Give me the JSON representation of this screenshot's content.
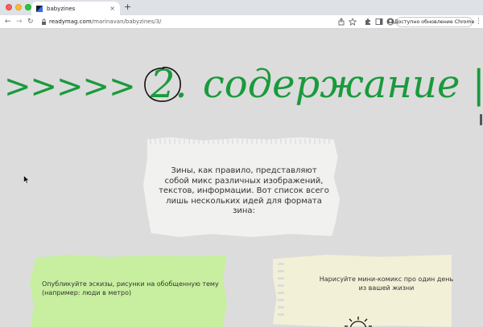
{
  "browser": {
    "tab": {
      "title": "babyzines",
      "close_glyph": "×"
    },
    "new_tab_glyph": "+",
    "nav": {
      "back_glyph": "←",
      "forward_glyph": "→",
      "reload_glyph": "↻"
    },
    "address": {
      "host": "readymag.com",
      "path": "/marinavan/babyzines/3/"
    },
    "update_button_label": "Доступно обновление Chrome",
    "menu_glyph": "⋮"
  },
  "page": {
    "heading": {
      "arrows": ">>>>>",
      "number": "2.",
      "title": "содержание | вид"
    },
    "intro_text": "Зины, как правило, представляют собой микс различных изображений, текстов, информации. Вот список всего лишь нескольких идей для формата зина:",
    "ideas": [
      {
        "text": "Опубликуйте эскизы, рисунки на обобщенную тему (например: люди в метро)",
        "color": "#c7ef9f"
      },
      {
        "text": "Нарисуйте мини-комикс про один день из вашей жизни",
        "color": "#f3f0d8"
      }
    ]
  },
  "colors": {
    "accent_green": "#1a9a3c",
    "page_background": "#dcdcdc"
  }
}
